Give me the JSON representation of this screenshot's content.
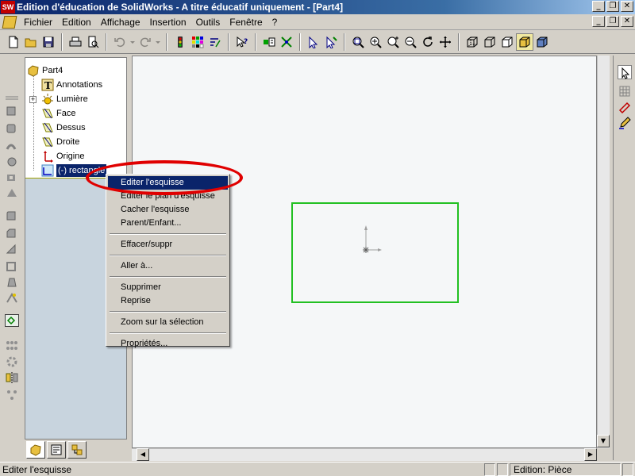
{
  "window": {
    "title": "Edition d'éducation de SolidWorks - A titre éducatif uniquement - [Part4]",
    "app_logo": "SW",
    "buttons": [
      "_",
      "❐",
      "✕"
    ]
  },
  "menubar": {
    "items": [
      "Fichier",
      "Edition",
      "Affichage",
      "Insertion",
      "Outils",
      "Fenêtre",
      "?"
    ],
    "doc_buttons": [
      "_",
      "❐",
      "✕"
    ]
  },
  "tree": {
    "root": "Part4",
    "items": [
      {
        "label": "Annotations",
        "icon": "annotations-icon"
      },
      {
        "label": "Lumière",
        "icon": "light-icon"
      },
      {
        "label": "Face",
        "icon": "plane-icon"
      },
      {
        "label": "Dessus",
        "icon": "plane-icon"
      },
      {
        "label": "Droite",
        "icon": "plane-icon"
      },
      {
        "label": "Origine",
        "icon": "origin-icon"
      },
      {
        "label": "(-) rectangle",
        "icon": "sketch-icon"
      }
    ],
    "expander": "+"
  },
  "context_menu": {
    "groups": [
      [
        "Editer l'esquisse",
        "Editer le plan d'esquisse",
        "Cacher l'esquisse",
        "Parent/Enfant..."
      ],
      [
        "Effacer/suppr"
      ],
      [
        "Aller à..."
      ],
      [
        "Supprimer",
        "Reprise"
      ],
      [
        "Zoom sur la sélection"
      ],
      [
        "Propriétés..."
      ]
    ],
    "highlighted": "Editer l'esquisse"
  },
  "scroll": {
    "up": "▲",
    "down": "▼",
    "left": "◀",
    "right": "▶"
  },
  "statusbar": {
    "text": "Editer l'esquisse",
    "mode": "Edition: Pièce"
  },
  "colors": {
    "title_start": "#0a246a",
    "menu_highlight": "#0a246a",
    "sketch_green": "#22c022",
    "annotation_red": "#e00000"
  }
}
